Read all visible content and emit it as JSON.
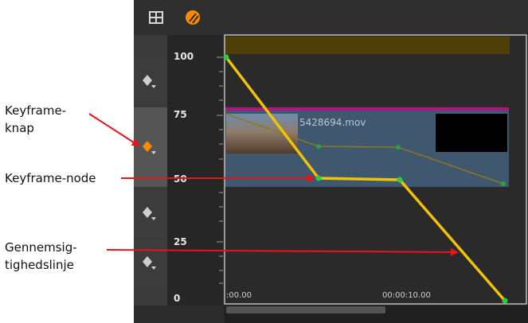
{
  "callouts": {
    "keyframe_knap_line1": "Keyframe-",
    "keyframe_knap_line2": "knap",
    "keyframe_node": "Keyframe-node",
    "gennemsig_line1": "Gennemsig-",
    "gennemsig_line2": "tighedslinje"
  },
  "scale": {
    "labels": [
      "100",
      "75",
      "50",
      "25",
      "0"
    ]
  },
  "clip": {
    "name": "5428694.mov"
  },
  "timeline": {
    "timecodes": [
      ":00.00",
      "00:00:10.00"
    ]
  },
  "toolbar": {
    "icons": [
      "grid-view-icon",
      "opacity-mode-icon"
    ]
  },
  "colors": {
    "opacity_line": "#f2c300",
    "keyframe_node": "#2ecc40",
    "callout_arrow": "#e8141b",
    "clip_border": "#b0167f",
    "active_keyframe": "#ff8a00"
  }
}
